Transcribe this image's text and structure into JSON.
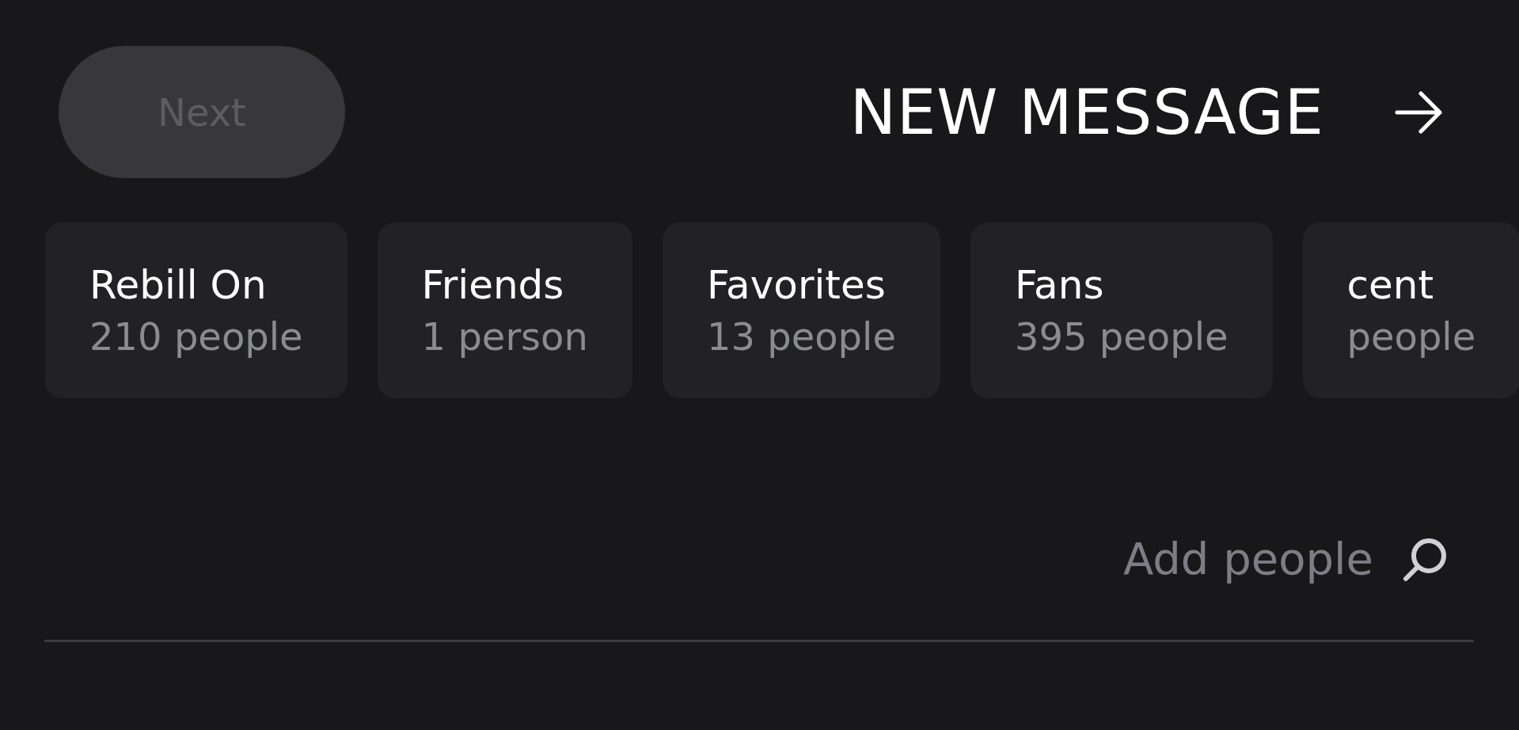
{
  "header": {
    "next_button": {
      "label": "Next",
      "disabled": true
    },
    "title": "NEW MESSAGE"
  },
  "lists": [
    {
      "name": "Rebill On",
      "count": "210 people"
    },
    {
      "name": "Friends",
      "count": "1 person"
    },
    {
      "name": "Favorites",
      "count": "13 people"
    },
    {
      "name": "Fans",
      "count": "395 people"
    },
    {
      "name": "cent",
      "count": "people"
    }
  ],
  "search": {
    "placeholder": "Add people"
  }
}
